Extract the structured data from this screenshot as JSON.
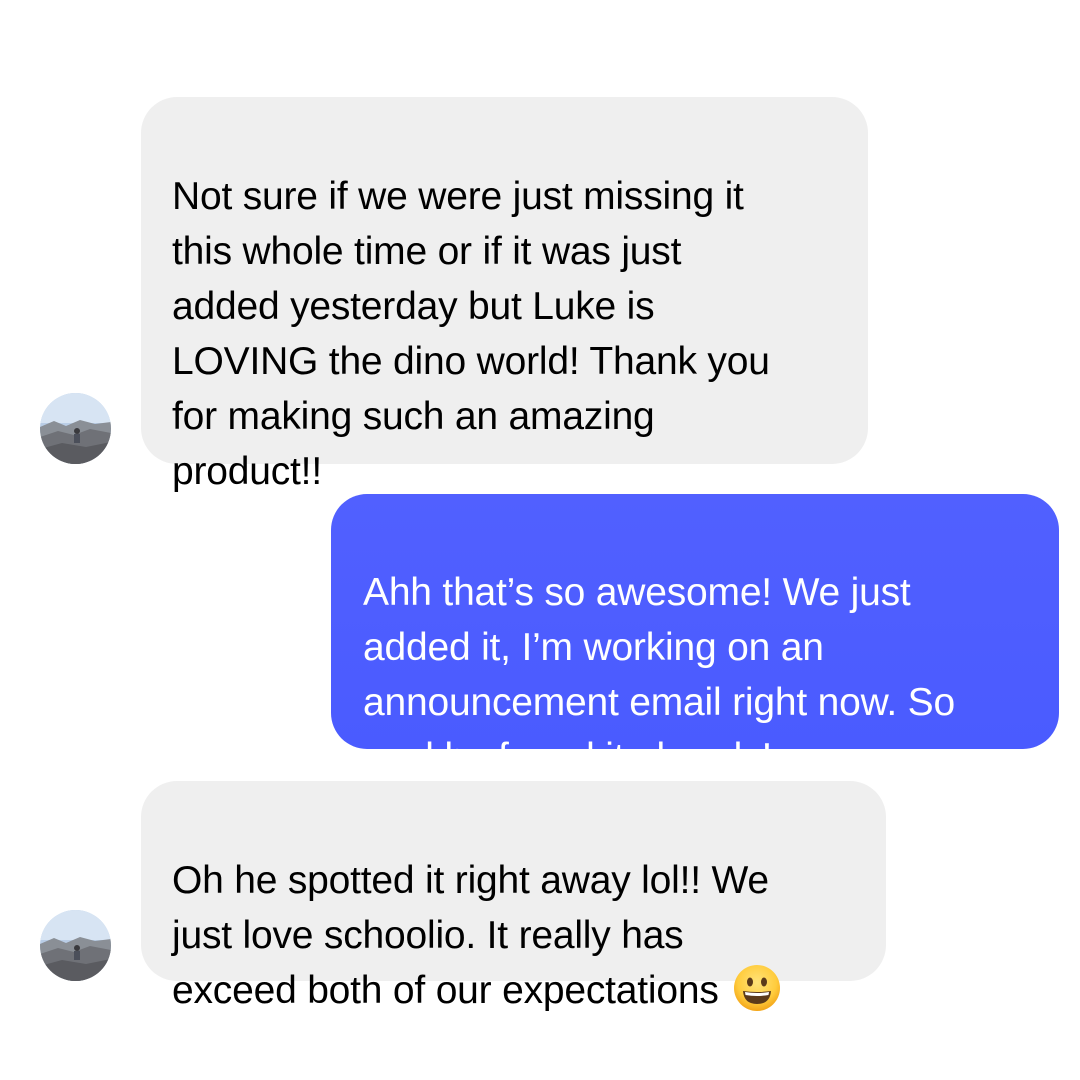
{
  "conversation": {
    "messages": [
      {
        "sender": "incoming",
        "text": "Not sure if we were just missing it\nthis whole time or if it was just\nadded yesterday but Luke is\nLOVING the dino world! Thank you\nfor making such an amazing\nproduct!!"
      },
      {
        "sender": "outgoing",
        "text": "Ahh that’s so awesome! We just\nadded it, I’m working on an\nannouncement email right now. So\ncool he found it already!"
      },
      {
        "sender": "incoming",
        "text": "Oh he spotted it right away lol!! We\njust love schoolio. It really has\nexceed both of our expectations",
        "emoji": "grinning-face-emoji"
      }
    ]
  },
  "colors": {
    "incoming_bubble": "#efefef",
    "outgoing_bubble": "#4a5bff",
    "incoming_text": "#000000",
    "outgoing_text": "#ffffff"
  }
}
